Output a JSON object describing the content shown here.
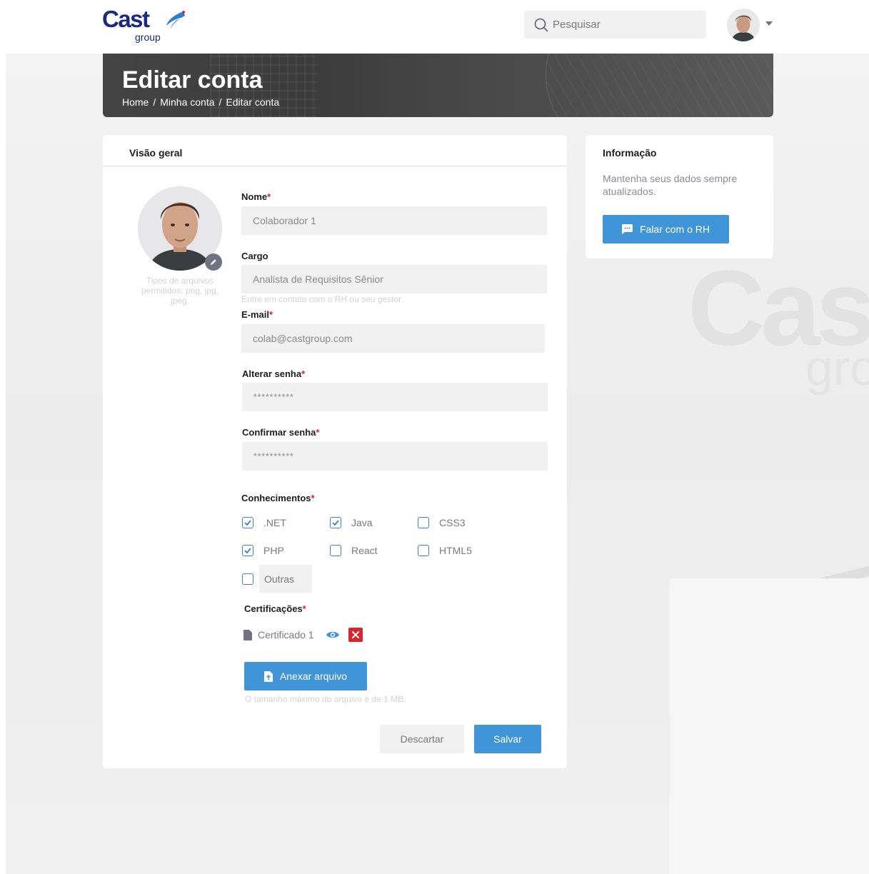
{
  "header": {
    "logo_text": "Cast",
    "logo_sub": "group",
    "search_placeholder": "Pesquisar"
  },
  "banner": {
    "title": "Editar conta",
    "breadcrumb": [
      "Home",
      "/",
      "Minha conta",
      "/",
      "Editar conta"
    ]
  },
  "overview": {
    "title": "Visão geral",
    "photo_hint": "Tipos de arquivos permitidos: png, jpg, jpeg.",
    "fields": {
      "name_label": "Nome",
      "name_value": "Colaborador 1",
      "role_label": "Cargo",
      "role_value": "Analista de Requisitos Sênior",
      "role_hint": "Entre em contato com o RH ou seu gestor.",
      "email_label": "E-mail",
      "email_value": "colab@castgroup.com",
      "password_label": "Alterar senha",
      "password_value": "**********",
      "confirm_label": "Confirmar senha",
      "confirm_value": "**********",
      "required_mark": "*"
    },
    "skills": {
      "label": "Conhecimentos",
      "items": [
        {
          "label": ".NET",
          "checked": true
        },
        {
          "label": "Java",
          "checked": true
        },
        {
          "label": "CSS3",
          "checked": false
        },
        {
          "label": "PHP",
          "checked": true
        },
        {
          "label": "React",
          "checked": false
        },
        {
          "label": "HTML5",
          "checked": false
        },
        {
          "label": "Outras",
          "checked": false
        }
      ]
    },
    "certifications": {
      "label": "Certificações",
      "file_name": "Certificado 1",
      "attach_label": "Anexar arquivo",
      "size_hint": "O tamanho máximo do arquivo é de  1 MB."
    },
    "actions": {
      "discard": "Descartar",
      "save": "Salvar"
    }
  },
  "info": {
    "title": "Informação",
    "text": "Mantenha seus dados sempre atualizados.",
    "button": "Falar com o RH"
  },
  "colors": {
    "primary": "#3f95d8",
    "required": "#d7262e",
    "checkbox": "#3f7fc8"
  }
}
